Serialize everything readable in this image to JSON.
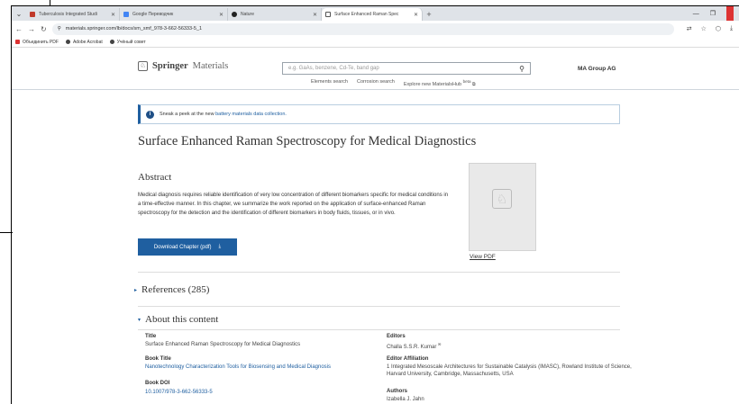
{
  "browser": {
    "tabs": [
      {
        "label": "Tuberculosis Integrated Studi",
        "fav_color": "#c0392b",
        "active": false
      },
      {
        "label": "Google Переводчик",
        "fav_color": "#4285f4",
        "active": false
      },
      {
        "label": "Nature",
        "fav_color": "#222222",
        "active": false
      },
      {
        "label": "Surface Enhanced Raman Spec",
        "fav_color": "#555555",
        "active": true
      }
    ],
    "url": "materials.springer.com/lb/docs/sm_smf_978-3-662-56333-5_1",
    "bookmarks": [
      {
        "label": "Объединить PDF",
        "color": "#d33"
      },
      {
        "label": "Adobe Acrobat",
        "color": "#444"
      },
      {
        "label": "Учёный совет",
        "color": "#444"
      }
    ]
  },
  "header": {
    "logo_brand": "Springer",
    "logo_suffix": "Materials",
    "search_placeholder": "e.g. GaAs, benzene, Cd-Te, band gap",
    "nav": [
      "Elements search",
      "Corrosion search",
      "Explore new MaterialsHub"
    ],
    "nav_beta": "beta",
    "account": "MA Group AG"
  },
  "banner": {
    "text": "Sneak a peek at the new",
    "link": "battery materials data collection."
  },
  "title": "Surface Enhanced Raman Spectroscopy for Medical Diagnostics",
  "abstract": {
    "heading": "Abstract",
    "text": "Medical diagnosis requires reliable identification of very low concentration of different biomarkers specific for medical conditions in a time-effective manner. In this chapter, we summarize the work reported on the application of surface-enhanced Raman spectroscopy for the detection and the identification of different biomarkers in body fluids, tissues, or in vivo.",
    "download_label": "Download Chapter (pdf)",
    "view_pdf": "View PDF"
  },
  "references_heading": "References (285)",
  "about_heading": "About this content",
  "meta": {
    "title_label": "Title",
    "title_value": "Surface Enhanced Raman Spectroscopy for Medical Diagnostics",
    "book_title_label": "Book Title",
    "book_title_value": "Nanotechnology Characterization Tools for Biosensing and Medical Diagnosis",
    "book_doi_label": "Book DOI",
    "book_doi_value": "10.1007/978-3-662-56333-5",
    "editors_label": "Editors",
    "editors_value": "Challa S.S.R. Kumar",
    "editor_aff_label": "Editor Affiliation",
    "editor_aff_value": "1 Integrated Mesoscale Architectures for Sustainable Catalysis (IMASC), Rowland Institute of Science, Harvard University, Cambridge, Massachusetts, USA",
    "authors_label": "Authors",
    "authors_value": "Izabella J. Jahn"
  }
}
